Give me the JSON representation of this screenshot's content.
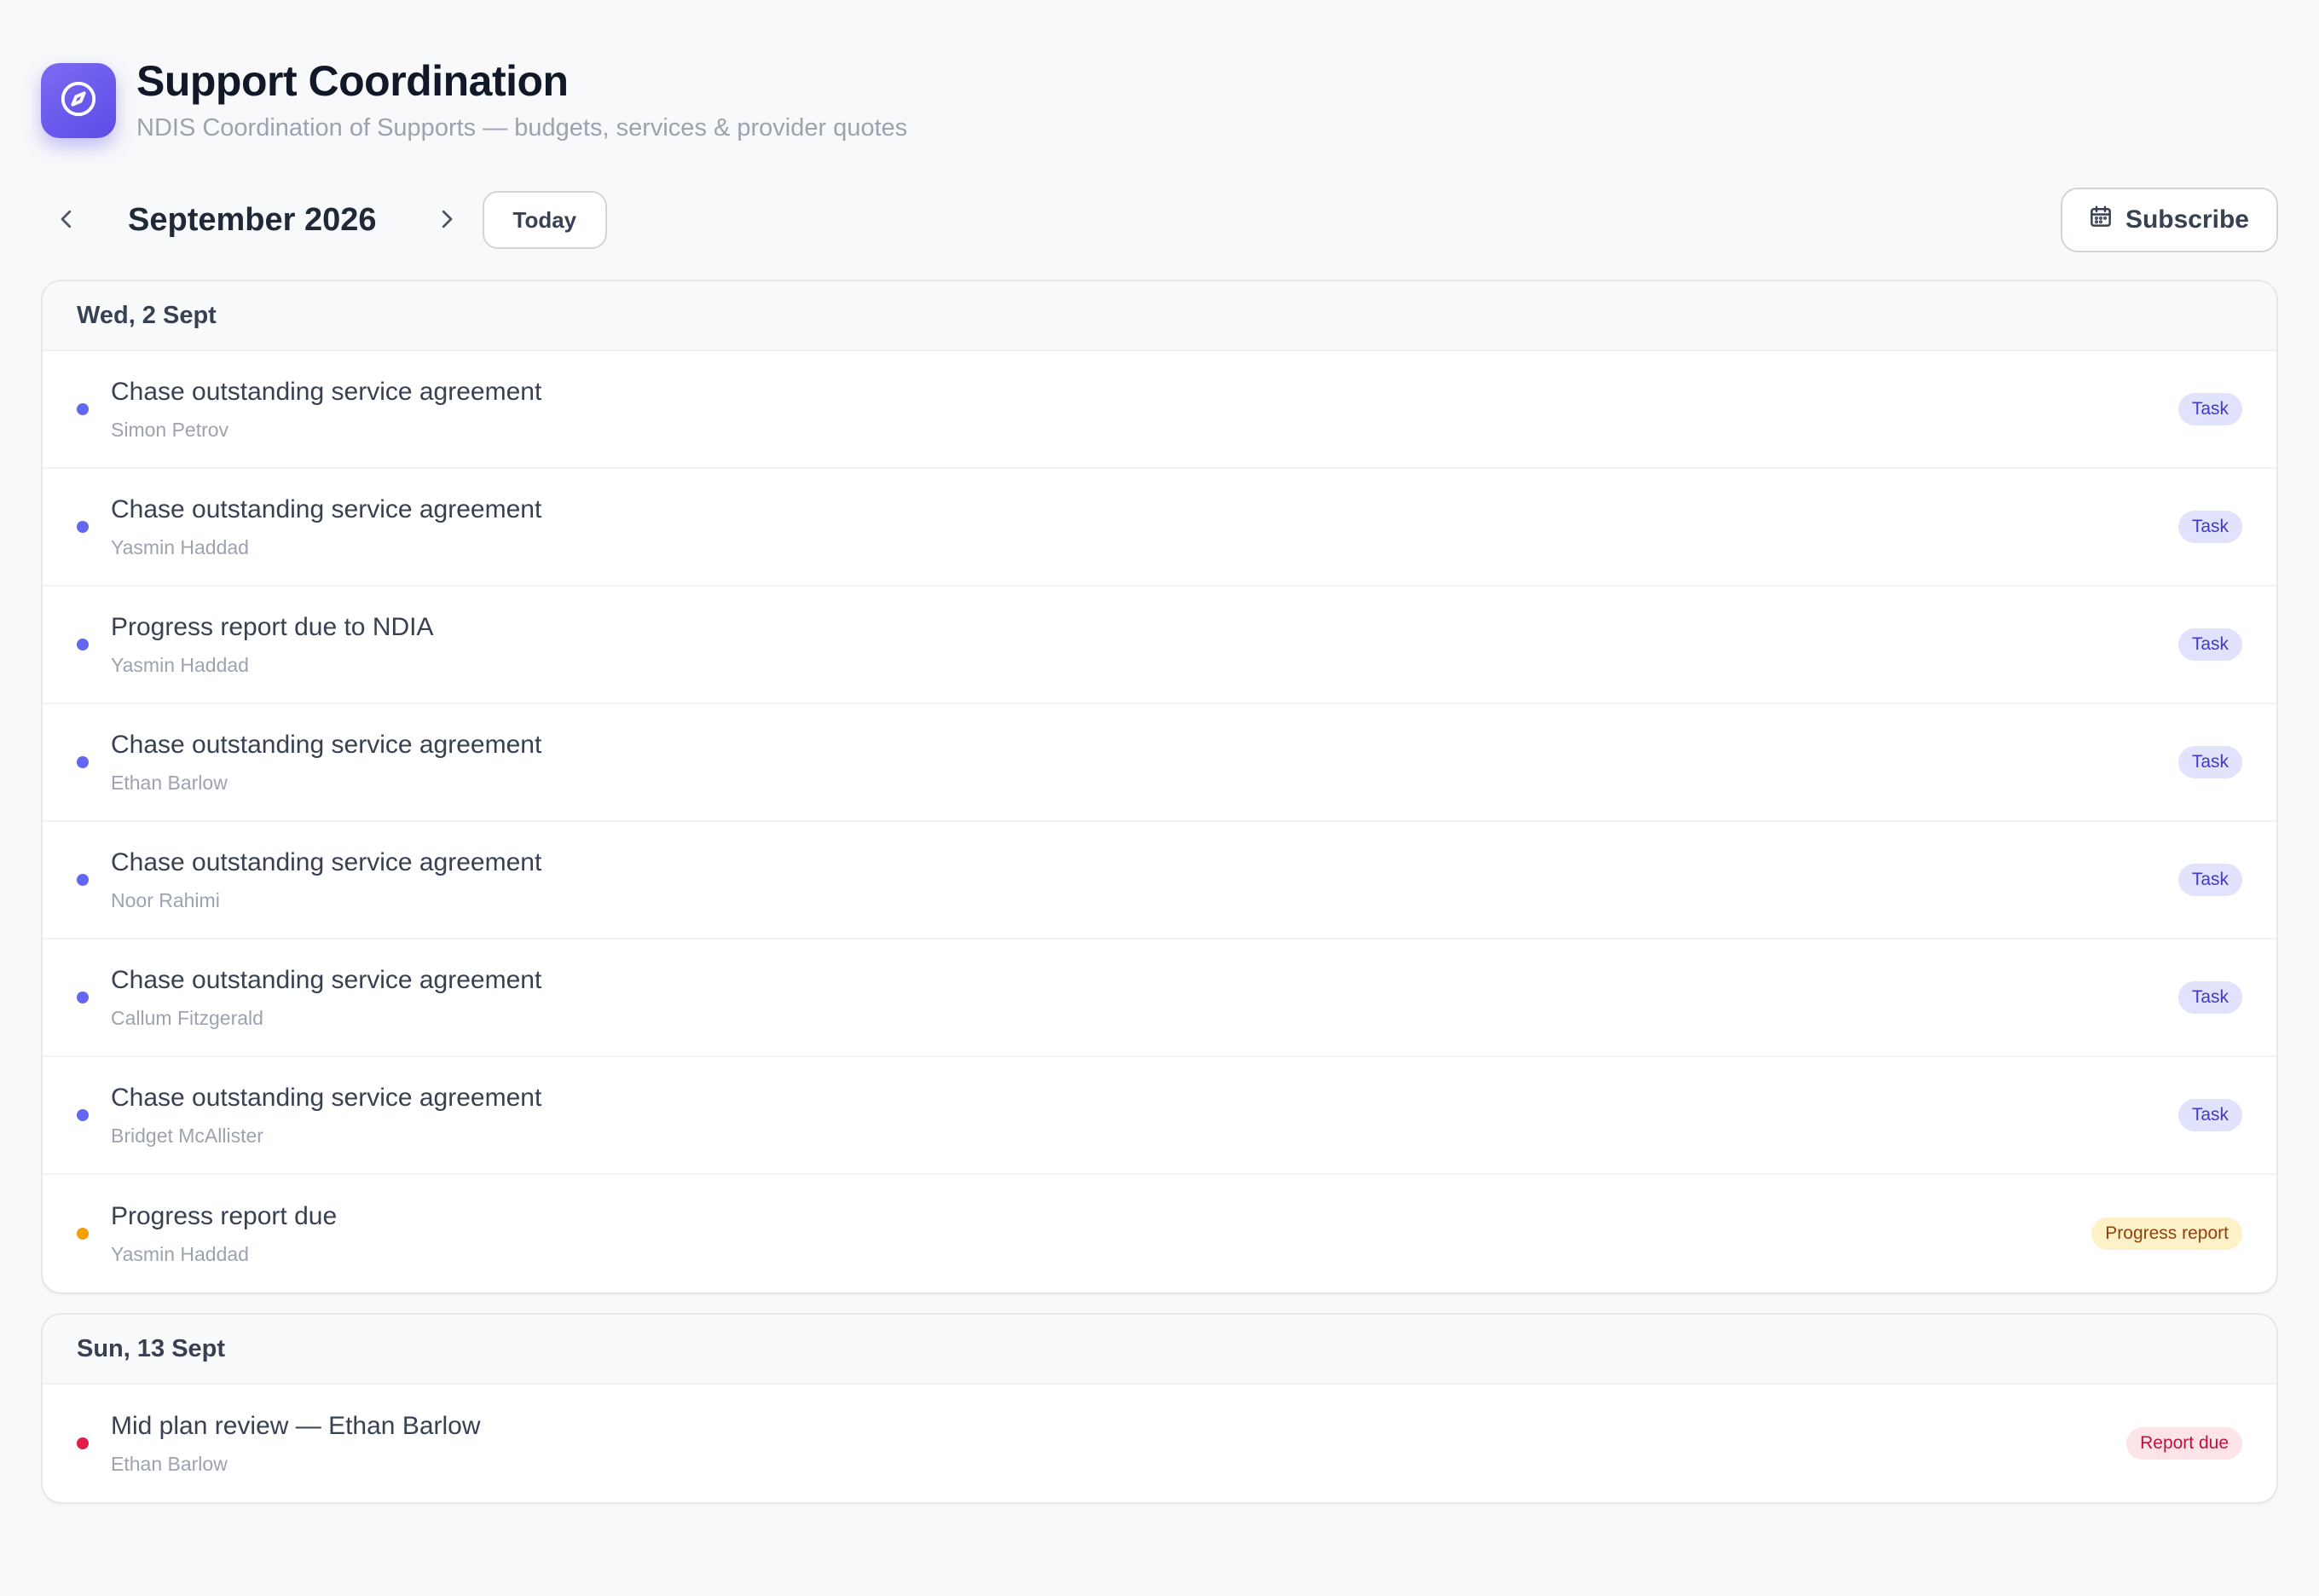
{
  "header": {
    "title": "Support Coordination",
    "subtitle": "NDIS Coordination of Supports — budgets, services & provider quotes",
    "logo_icon": "compass-icon"
  },
  "toolbar": {
    "month": "September 2026",
    "today_label": "Today",
    "subscribe_label": "Subscribe",
    "prev_icon": "chevron-left-icon",
    "next_icon": "chevron-right-icon",
    "subscribe_icon": "calendar-icon"
  },
  "colors": {
    "accent": "#5b4ce6",
    "task_dot": "#6366f1",
    "progress_dot": "#f59e0b",
    "report_dot": "#e11d48"
  },
  "days": [
    {
      "label": "Wed, 2 Sept",
      "events": [
        {
          "title": "Chase outstanding service agreement",
          "person": "Simon Petrov",
          "badge": "Task",
          "kind": "task"
        },
        {
          "title": "Chase outstanding service agreement",
          "person": "Yasmin Haddad",
          "badge": "Task",
          "kind": "task"
        },
        {
          "title": "Progress report due to NDIA",
          "person": "Yasmin Haddad",
          "badge": "Task",
          "kind": "task"
        },
        {
          "title": "Chase outstanding service agreement",
          "person": "Ethan Barlow",
          "badge": "Task",
          "kind": "task"
        },
        {
          "title": "Chase outstanding service agreement",
          "person": "Noor Rahimi",
          "badge": "Task",
          "kind": "task"
        },
        {
          "title": "Chase outstanding service agreement",
          "person": "Callum Fitzgerald",
          "badge": "Task",
          "kind": "task"
        },
        {
          "title": "Chase outstanding service agreement",
          "person": "Bridget McAllister",
          "badge": "Task",
          "kind": "task"
        },
        {
          "title": "Progress report due",
          "person": "Yasmin Haddad",
          "badge": "Progress report",
          "kind": "progress"
        }
      ]
    },
    {
      "label": "Sun, 13 Sept",
      "events": [
        {
          "title": "Mid plan review — Ethan Barlow",
          "person": "Ethan Barlow",
          "badge": "Report due",
          "kind": "report"
        }
      ]
    }
  ]
}
